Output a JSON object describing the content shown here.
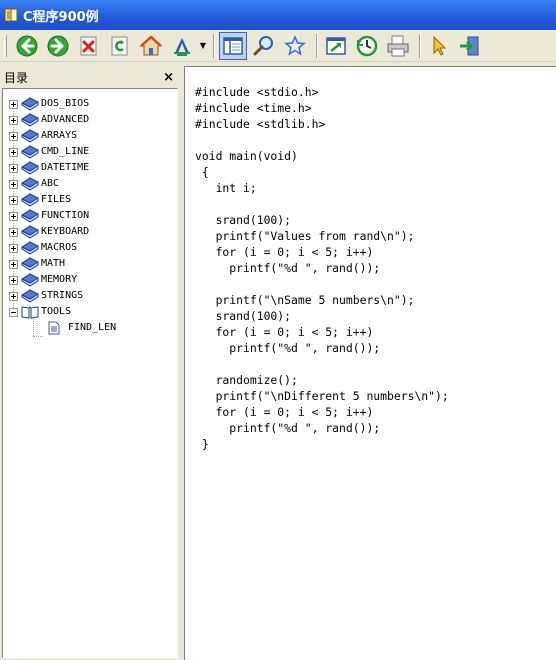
{
  "window": {
    "title": "C程序900例"
  },
  "toolbar": {
    "buttons": [
      {
        "name": "back-button",
        "icon": "back-arrow-icon"
      },
      {
        "name": "forward-button",
        "icon": "forward-arrow-icon"
      },
      {
        "name": "stop-button",
        "icon": "stop-icon"
      },
      {
        "name": "refresh-button",
        "icon": "refresh-icon"
      },
      {
        "name": "home-button",
        "icon": "home-icon"
      },
      {
        "name": "font-button",
        "icon": "font-icon"
      },
      {
        "name": "hide-tree-button",
        "icon": "tree-pane-icon"
      },
      {
        "name": "search-button",
        "icon": "search-icon"
      },
      {
        "name": "favorites-button",
        "icon": "star-icon"
      },
      {
        "name": "jump-button",
        "icon": "jump-window-icon"
      },
      {
        "name": "history-button",
        "icon": "history-icon"
      },
      {
        "name": "print-button",
        "icon": "printer-icon"
      },
      {
        "name": "pointer-button",
        "icon": "pointer-icon"
      },
      {
        "name": "exit-button",
        "icon": "exit-icon"
      }
    ]
  },
  "tree": {
    "header": "目录",
    "close_label": "×",
    "items": [
      {
        "label": "DOS_BIOS",
        "expanded": false
      },
      {
        "label": "ADVANCED",
        "expanded": false
      },
      {
        "label": "ARRAYS",
        "expanded": false
      },
      {
        "label": "CMD_LINE",
        "expanded": false
      },
      {
        "label": "DATETIME",
        "expanded": false
      },
      {
        "label": "ABC",
        "expanded": false
      },
      {
        "label": "FILES",
        "expanded": false
      },
      {
        "label": "FUNCTION",
        "expanded": false
      },
      {
        "label": "KEYBOARD",
        "expanded": false
      },
      {
        "label": "MACROS",
        "expanded": false
      },
      {
        "label": "MATH",
        "expanded": false
      },
      {
        "label": "MEMORY",
        "expanded": false
      },
      {
        "label": "STRINGS",
        "expanded": false
      },
      {
        "label": "TOOLS",
        "expanded": true
      }
    ],
    "child": {
      "label": "FIND_LEN"
    }
  },
  "code": {
    "lines": [
      "#include <stdio.h>",
      "#include <time.h>",
      "#include <stdlib.h>",
      "",
      "void main(void)",
      " {",
      "   int i;",
      "",
      "   srand(100);",
      "   printf(\"Values from rand\\n\");",
      "   for (i = 0; i < 5; i++)",
      "     printf(\"%d \", rand());",
      "",
      "   printf(\"\\nSame 5 numbers\\n\");",
      "   srand(100);",
      "   for (i = 0; i < 5; i++)",
      "     printf(\"%d \", rand());",
      "",
      "   randomize();",
      "   printf(\"\\nDifferent 5 numbers\\n\");",
      "   for (i = 0; i < 5; i++)",
      "     printf(\"%d \", rand());",
      " }"
    ]
  }
}
